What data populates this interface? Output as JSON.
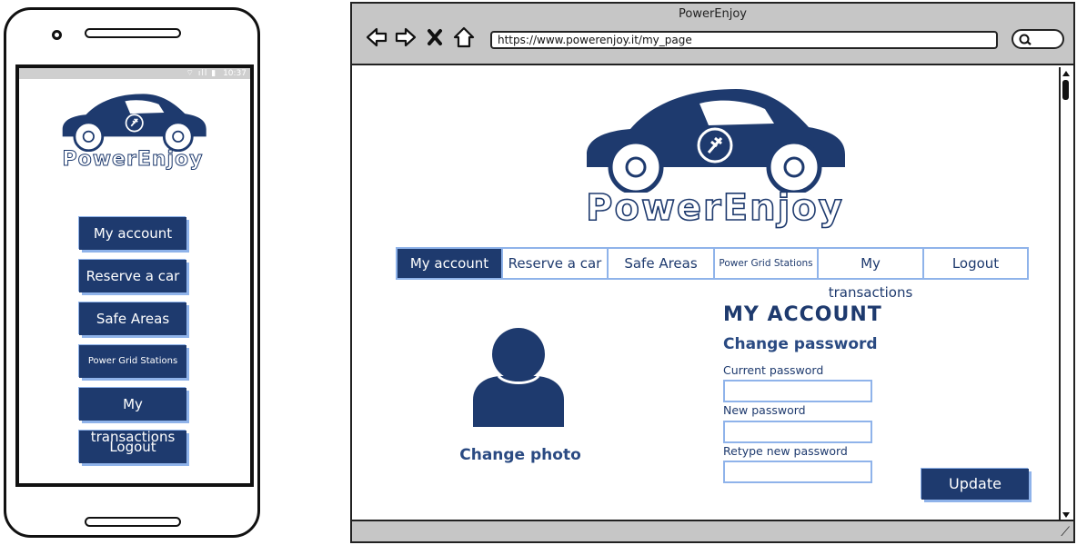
{
  "phone": {
    "status": {
      "icons": "⌔ ıll ▮",
      "time": "10:37"
    },
    "brand": "PowerEnjoy",
    "menu": [
      {
        "label": "My account"
      },
      {
        "label": "Reserve a car"
      },
      {
        "label": "Safe Areas"
      },
      {
        "label": "Power Grid Stations"
      },
      {
        "label": "My transactions"
      },
      {
        "label": "Logout"
      }
    ]
  },
  "browser": {
    "title": "PowerEnjoy",
    "url": "https://www.powerenjoy.it/my_page",
    "brand": "PowerEnjoy",
    "nav": [
      {
        "label": "My account",
        "active": true
      },
      {
        "label": "Reserve a car",
        "active": false
      },
      {
        "label": "Safe Areas",
        "active": false
      },
      {
        "label": "Power Grid Stations",
        "active": false
      },
      {
        "label": "My transactions",
        "active": false
      },
      {
        "label": "Logout",
        "active": false
      }
    ],
    "profile": {
      "change_photo": "Change photo"
    },
    "account": {
      "title": "MY ACCOUNT",
      "subtitle": "Change password",
      "current_label": "Current password",
      "current_value": "",
      "new_label": "New password",
      "new_value": "",
      "retype_label": "Retype new password",
      "retype_value": "",
      "update_label": "Update"
    }
  },
  "colors": {
    "primary": "#1e3a6e",
    "accent": "#8fb3ea",
    "chrome": "#c6c6c6"
  }
}
